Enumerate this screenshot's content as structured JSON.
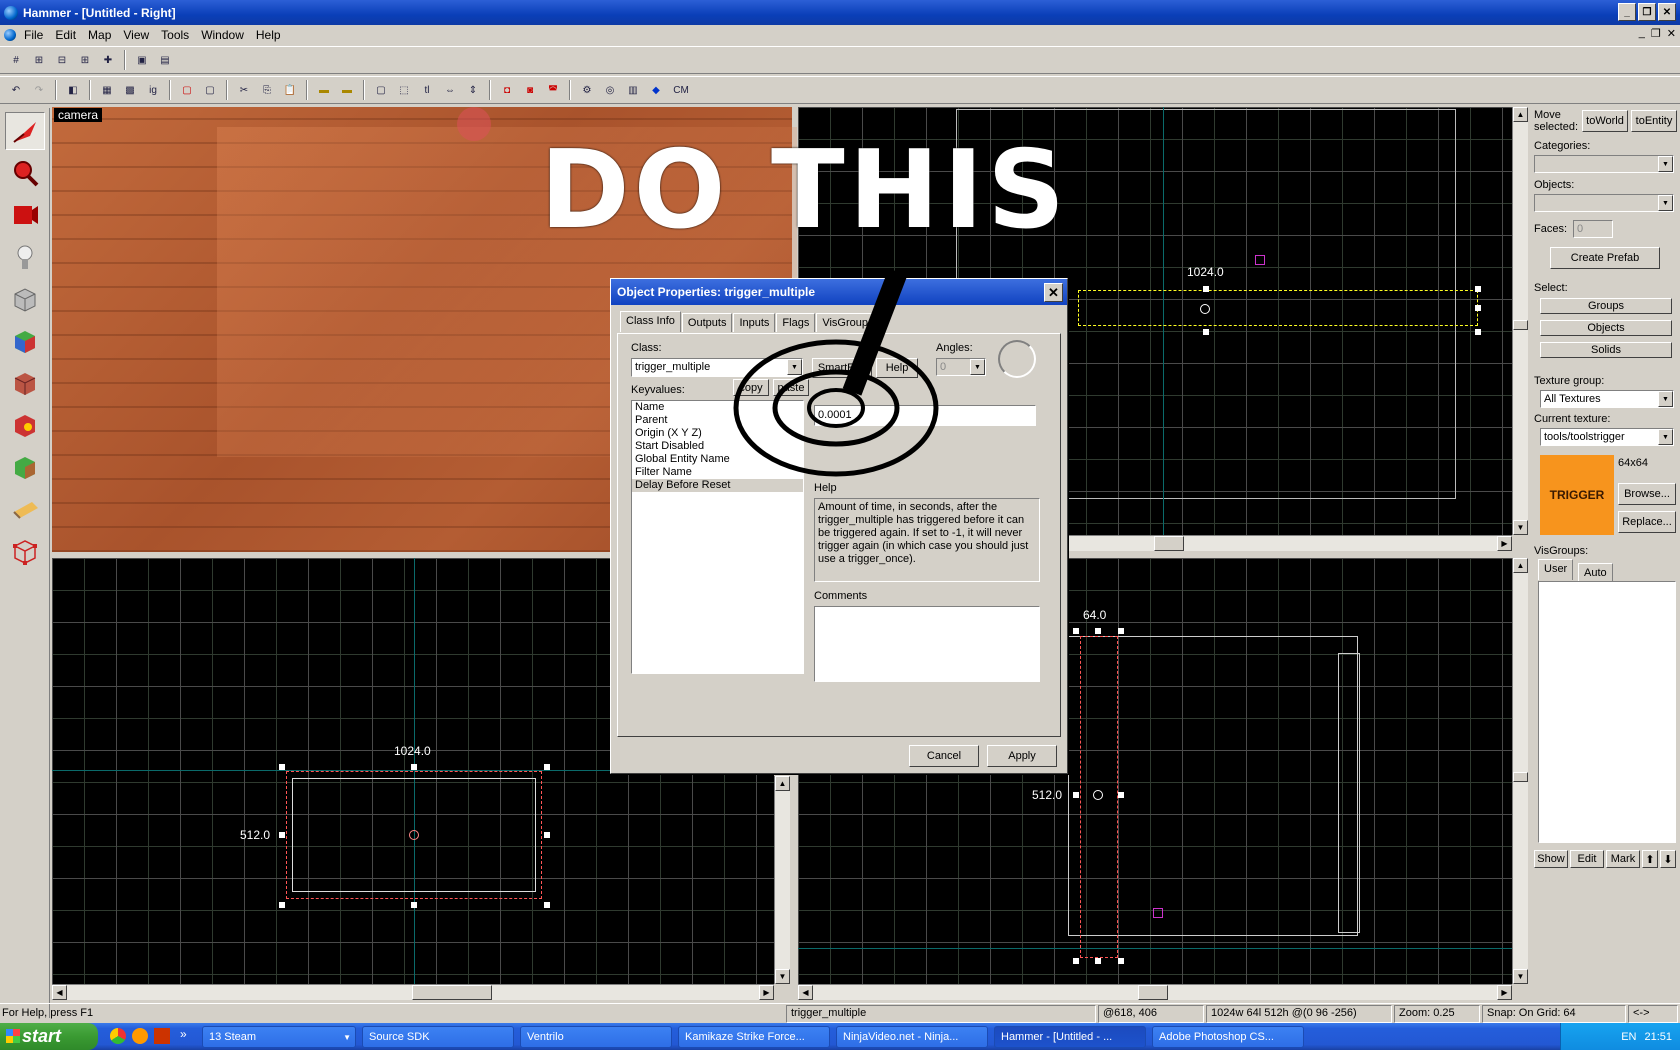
{
  "window": {
    "title": "Hammer - [Untitled - Right]",
    "btn_min": "_",
    "btn_max": "❐",
    "btn_close": "✕"
  },
  "menu": {
    "items": [
      "File",
      "Edit",
      "Map",
      "View",
      "Tools",
      "Window",
      "Help"
    ],
    "mdi_min": "_",
    "mdi_restore": "❐",
    "mdi_close": "✕"
  },
  "toolbar2": {
    "ig_label": "ig",
    "tl_label": "tl",
    "cm_label": "CM"
  },
  "camera": {
    "label": "camera"
  },
  "overlay": {
    "text": "DO THIS"
  },
  "views": {
    "top": {
      "dim_label": "1024.0"
    },
    "front": {
      "dim_w": "1024.0",
      "dim_h": "512.0"
    },
    "side": {
      "dim_w": "64.0",
      "dim_h": "512.0"
    }
  },
  "dialog": {
    "title": "Object Properties: trigger_multiple",
    "close": "✕",
    "tabs": [
      "Class Info",
      "Outputs",
      "Inputs",
      "Flags",
      "VisGroups"
    ],
    "class_label": "Class:",
    "class_value": "trigger_multiple",
    "smart_edit": "SmartEdit",
    "help_btn": "Help",
    "angles_label": "Angles:",
    "angles_value": "0",
    "keyvalues_label": "Keyvalues:",
    "copy_btn": "copy",
    "paste_btn": "paste",
    "keyvalues": [
      "Name",
      "Parent",
      "Origin (X Y Z)",
      "Start Disabled",
      "Global Entity Name",
      "Filter Name",
      "Delay Before Reset"
    ],
    "value_input": "0.0001",
    "help_label": "Help",
    "help_text": "Amount of time, in seconds, after the trigger_multiple has triggered before it can be triggered again. If set to -1, it will never trigger again (in which case you should just use a trigger_once).",
    "comments_label": "Comments",
    "cancel": "Cancel",
    "apply": "Apply"
  },
  "right_panel": {
    "move_selected": "Move selected:",
    "to_world": "toWorld",
    "to_entity": "toEntity",
    "categories": "Categories:",
    "objects": "Objects:",
    "faces": "Faces:",
    "faces_value": "0",
    "create_prefab": "Create Prefab",
    "select": "Select:",
    "groups": "Groups",
    "objects_btn": "Objects",
    "solids": "Solids",
    "texture_group": "Texture group:",
    "texture_group_value": "All Textures",
    "current_texture": "Current texture:",
    "current_texture_value": "tools/toolstrigger",
    "texture_size": "64x64",
    "texture_preview": "TRIGGER",
    "browse": "Browse...",
    "replace": "Replace...",
    "visgroups": "VisGroups:",
    "user_tab": "User",
    "auto_tab": "Auto",
    "show": "Show",
    "edit": "Edit",
    "mark": "Mark"
  },
  "status": {
    "help": "For Help, press F1",
    "selection": "trigger_multiple",
    "coords": "@618, 406",
    "size": "1024w 64l 512h @(0 96 -256)",
    "zoom": "Zoom: 0.25",
    "snap": "Snap: On Grid: 64",
    "arrows": "<->"
  },
  "taskbar": {
    "start": "start",
    "tasks": [
      "13 Steam",
      "Source SDK",
      "Ventrilo",
      "Kamikaze Strike Force...",
      "NinjaVideo.net - Ninja...",
      "Hammer - [Untitled - ...",
      "Adobe Photoshop CS..."
    ],
    "lang": "EN",
    "time": "21:51"
  },
  "colors": {
    "accent": "#0a3fb8",
    "trigger": "#f7941d",
    "wire": "#ffff22"
  }
}
